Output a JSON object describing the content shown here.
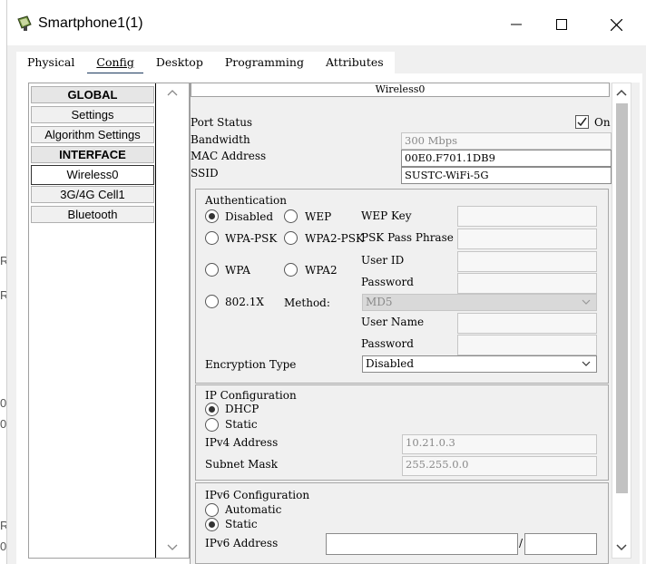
{
  "window": {
    "title": "Smartphone1(1)"
  },
  "edge_glyphs": [
    "R",
    "R",
    "0",
    "0",
    "R",
    "0"
  ],
  "tabs": [
    {
      "label": "Physical"
    },
    {
      "label": "Config"
    },
    {
      "label": "Desktop"
    },
    {
      "label": "Programming"
    },
    {
      "label": "Attributes"
    }
  ],
  "nav": {
    "global": "GLOBAL",
    "settings": "Settings",
    "algorithm": "Algorithm Settings",
    "interface": "INTERFACE",
    "wireless": "Wireless0",
    "cell": "3G/4G Cell1",
    "bluetooth": "Bluetooth"
  },
  "panel": {
    "title": "Wireless0",
    "port_status_label": "Port Status",
    "port_on_label": "On",
    "port_on_checked": true,
    "bandwidth_label": "Bandwidth",
    "bandwidth_value": "300 Mbps",
    "mac_label": "MAC Address",
    "mac_value": "00E0.F701.1DB9",
    "ssid_label": "SSID",
    "ssid_value": "SUSTC-WiFi-5G"
  },
  "auth": {
    "title": "Authentication",
    "disabled": "Disabled",
    "wep": "WEP",
    "wep_key": "WEP Key",
    "wpa_psk": "WPA-PSK",
    "wpa2_psk": "WPA2-PSK",
    "psk_phrase": "PSK Pass Phrase",
    "wpa": "WPA",
    "wpa2": "WPA2",
    "user_id": "User ID",
    "password": "Password",
    "x8021": "802.1X",
    "method_label": "Method:",
    "method_value": "MD5",
    "user_name": "User Name",
    "password2": "Password",
    "enc_label": "Encryption Type",
    "enc_value": "Disabled",
    "selected": "Disabled"
  },
  "ip": {
    "title": "IP Configuration",
    "dhcp": "DHCP",
    "static": "Static",
    "ipv4_label": "IPv4 Address",
    "ipv4_value": "10.21.0.3",
    "mask_label": "Subnet Mask",
    "mask_value": "255.255.0.0",
    "selected": "DHCP"
  },
  "ipv6": {
    "title": "IPv6 Configuration",
    "automatic": "Automatic",
    "static": "Static",
    "addr_label": "IPv6 Address",
    "slash": "/",
    "selected": "Static"
  }
}
